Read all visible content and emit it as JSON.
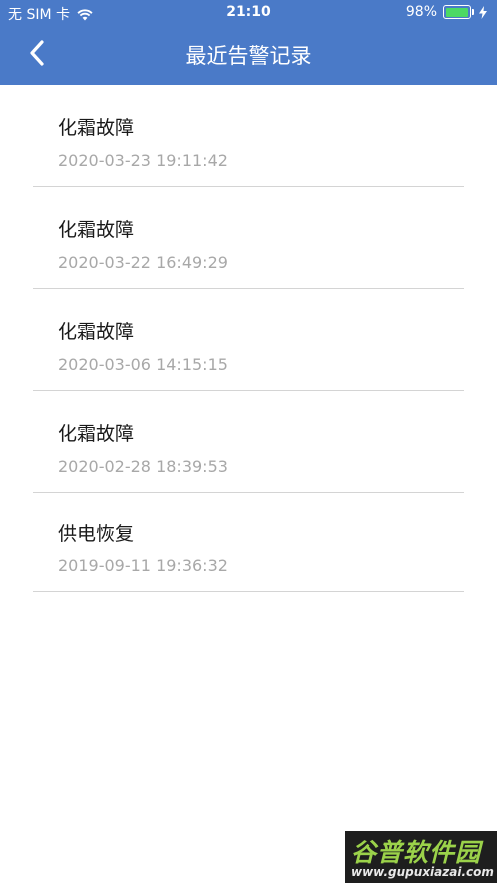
{
  "status_bar": {
    "carrier": "无 SIM 卡",
    "time": "21:10",
    "battery_percent": "98%",
    "battery_level": 0.98,
    "battery_color": "#4cd964"
  },
  "nav": {
    "title": "最近告警记录",
    "back_icon": "chevron-left-icon",
    "background": "#4a7ac8"
  },
  "records": [
    {
      "title": "化霜故障",
      "time": "2020-03-23 19:11:42"
    },
    {
      "title": "化霜故障",
      "time": "2020-03-22 16:49:29"
    },
    {
      "title": "化霜故障",
      "time": "2020-03-06 14:15:15"
    },
    {
      "title": "化霜故障",
      "time": "2020-02-28 18:39:53"
    },
    {
      "title": "供电恢复",
      "time": "2019-09-11 19:36:32"
    }
  ],
  "watermark": {
    "title": "谷普软件园",
    "url": "www.gupuxiazai.com"
  }
}
